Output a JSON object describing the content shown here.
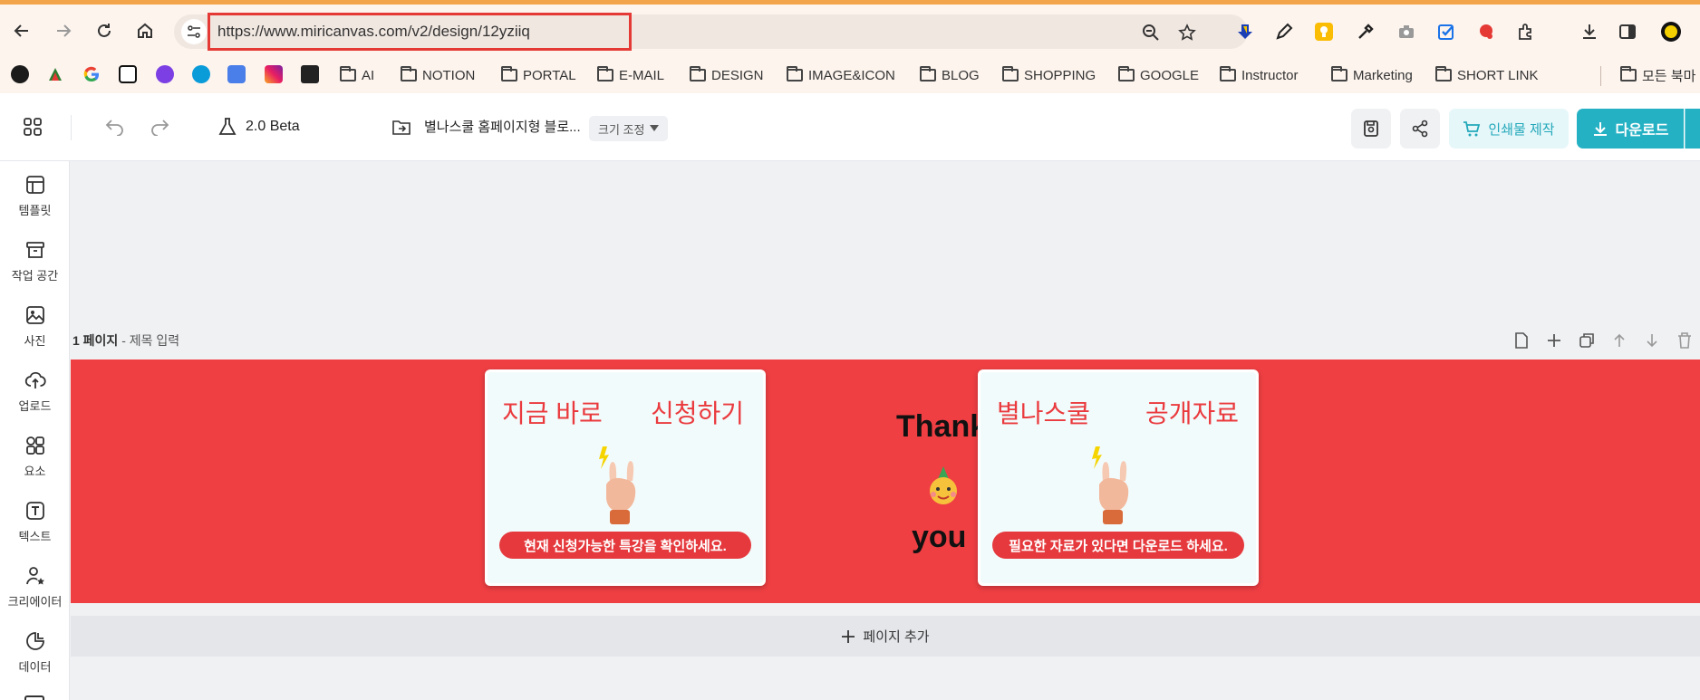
{
  "browser": {
    "url": "https://www.miricanvas.com/v2/design/12yziiq",
    "bookmark_folders": [
      "AI",
      "NOTION",
      "PORTAL",
      "E-MAIL",
      "DESIGN",
      "IMAGE&ICON",
      "BLOG",
      "SHOPPING",
      "GOOGLE",
      "Instructor",
      "Marketing",
      "SHORT LINK"
    ],
    "all_bookmarks_label": "모든 북마"
  },
  "header": {
    "version_label": "2.0 Beta",
    "document_title": "별나스쿨 홈페이지형 블로...",
    "resize_label": "크기 조정",
    "print_label": "인쇄물 제작",
    "download_label": "다운로드"
  },
  "sidebar": {
    "items": [
      {
        "label": "템플릿",
        "icon": "template-icon"
      },
      {
        "label": "작업 공간",
        "icon": "archive-icon"
      },
      {
        "label": "사진",
        "icon": "photo-icon"
      },
      {
        "label": "업로드",
        "icon": "upload-icon"
      },
      {
        "label": "요소",
        "icon": "elements-icon"
      },
      {
        "label": "텍스트",
        "icon": "text-icon"
      },
      {
        "label": "크리에이터",
        "icon": "creator-icon"
      },
      {
        "label": "데이터",
        "icon": "chart-icon"
      }
    ]
  },
  "page": {
    "number_label": "1 페이지",
    "title_placeholder": "제목 입력",
    "add_page_label": "페이지 추가"
  },
  "design": {
    "card_left": {
      "title_a": "지금 바로",
      "title_b": "신청하기",
      "pill": "현재 신청가능한 특강을 확인하세요."
    },
    "card_right": {
      "title_a": "별나스쿨",
      "title_b": "공개자료",
      "pill": "필요한 자료가 있다면 다운로드 하세요."
    },
    "thank_text": "Thank",
    "you_text": "you"
  },
  "colors": {
    "banner_red": "#ef3f43",
    "accent_teal": "#25b1c4",
    "url_highlight": "#e53935"
  }
}
